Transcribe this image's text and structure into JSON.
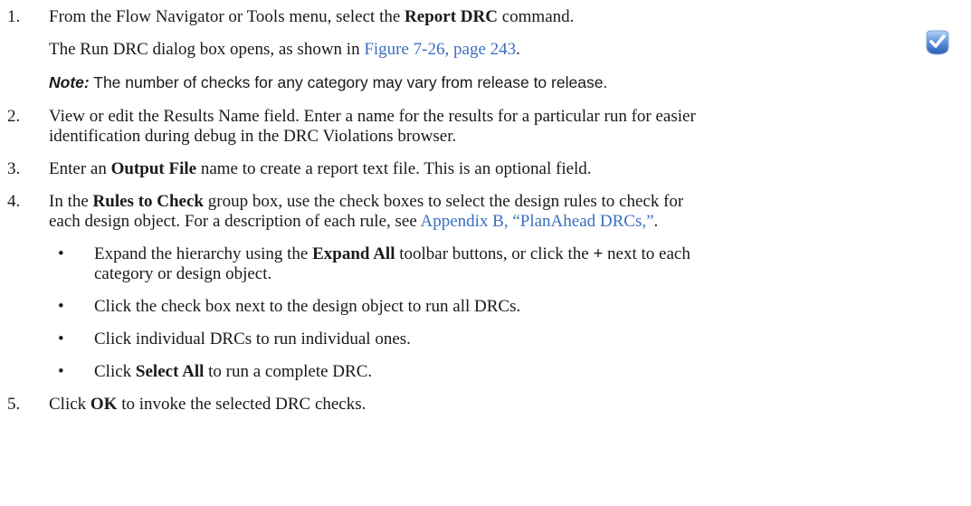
{
  "steps": [
    {
      "num": "1.",
      "pre": "From the Flow Navigator or Tools menu, select the ",
      "bold": "Report DRC",
      "post": " command."
    },
    {
      "num": "2.",
      "line1": "View or edit the Results Name field. Enter a name for the results for a particular run for easier",
      "line2": "identification during debug in the DRC Violations browser."
    },
    {
      "num": "3.",
      "pre": "Enter an ",
      "bold": "Output File",
      "post": " name to create a report text file. This is an optional field."
    },
    {
      "num": "4.",
      "pre": "In the ",
      "bold": "Rules to Check",
      "post": " group box, use the check boxes to select the design rules to check for",
      "line2_pre": "each design object. For a description of each rule, see ",
      "line2_link": "Appendix B, “PlanAhead DRCs,”",
      "line2_post": "."
    },
    {
      "num": "5.",
      "pre": "Click ",
      "bold": "OK",
      "post": " to invoke the selected DRC checks."
    }
  ],
  "step1_followup": {
    "pre": "The Run DRC dialog box opens, as shown in ",
    "link": "Figure 7-26, page 243",
    "post": "."
  },
  "note": {
    "label": "Note:",
    "text": " The number of checks for any category may vary from release to release."
  },
  "bullets": [
    {
      "dot": "•",
      "pre": "Expand the hierarchy using the ",
      "bold": "Expand All",
      "post": " toolbar buttons, or click the ",
      "bold2": "+",
      "post2": " next to each",
      "line2": "category or design object."
    },
    {
      "dot": "•",
      "text": "Click the check box next to the design object to run all DRCs."
    },
    {
      "dot": "•",
      "text": "Click individual DRCs to run individual ones."
    },
    {
      "dot": "•",
      "pre": "Click ",
      "bold": "Select All",
      "post": " to run a complete DRC."
    }
  ],
  "icon": "report-drc-check-icon",
  "colors": {
    "link": "#3a6fc0",
    "icon_blue": "#3b74c9"
  }
}
